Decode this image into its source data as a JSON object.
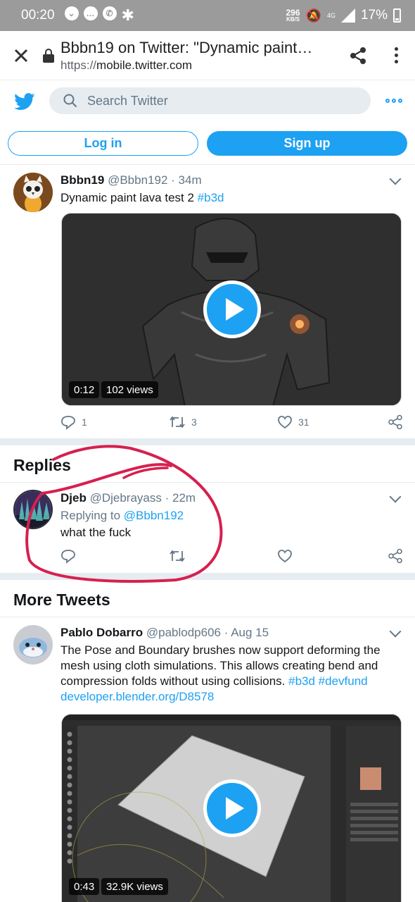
{
  "status_bar": {
    "time": "00:20",
    "net_speed_value": "296",
    "net_speed_unit": "KB/S",
    "network": "4G",
    "battery": "17%"
  },
  "browser": {
    "page_title": "Bbbn19 on Twitter: \"Dynamic paint…",
    "url_scheme": "https://",
    "url_host": "mobile.twitter.com"
  },
  "twitter_header": {
    "search_placeholder": "Search Twitter",
    "login_label": "Log in",
    "signup_label": "Sign up"
  },
  "main_tweet": {
    "name": "Bbbn19",
    "handle": "@Bbbn192",
    "time": "34m",
    "text": "Dynamic paint lava test 2 ",
    "hashtag": "#b3d",
    "video_duration": "0:12",
    "video_views": "102 views",
    "replies": "1",
    "retweets": "3",
    "likes": "31"
  },
  "replies_section": {
    "title": "Replies"
  },
  "reply": {
    "name": "Djeb",
    "handle": "@Djebrayass",
    "time": "22m",
    "replying_prefix": "Replying to ",
    "replying_to": "@Bbbn192",
    "text": "what the fuck"
  },
  "more_section": {
    "title": "More Tweets"
  },
  "more_tweet": {
    "name": "Pablo Dobarro",
    "handle": "@pablodp606",
    "time": "Aug 15",
    "text_line1": "The Pose and Boundary brushes now support deforming the",
    "text_line2": "mesh using cloth simulations. This allows creating bend and",
    "text_line3": "compression folds without using collisions. ",
    "hashtag1": "#b3d",
    "hashtag2": "#devfund",
    "link": "developer.blender.org/D8578",
    "video_duration": "0:43",
    "video_views": "32.9K views"
  },
  "colors": {
    "twitter_blue": "#1da1f2",
    "annotation_red": "#d6204f",
    "status_bar": "#9b9b9b"
  }
}
